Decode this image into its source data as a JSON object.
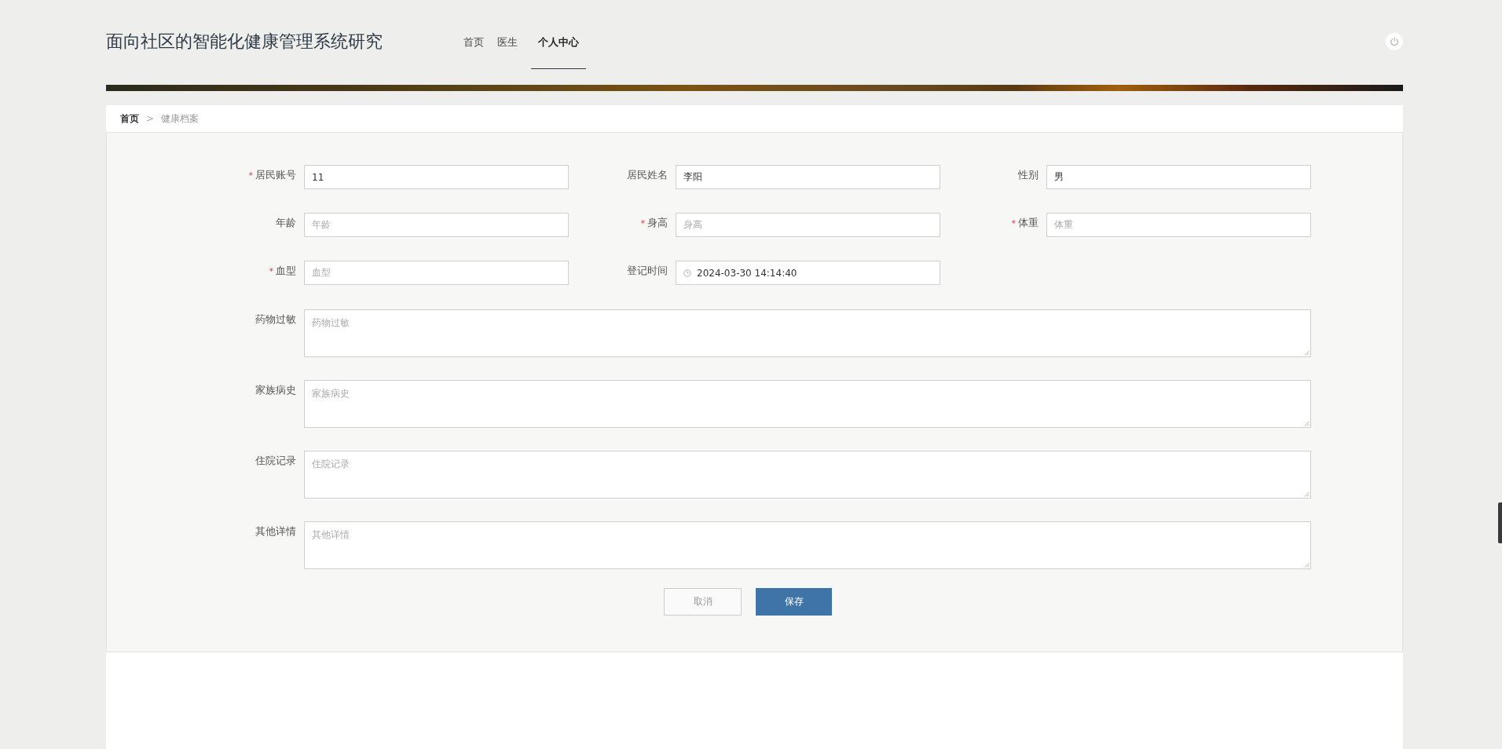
{
  "header": {
    "title": "面向社区的智能化健康管理系统研究",
    "nav": [
      {
        "label": "首页",
        "selected": false
      },
      {
        "label": "医生",
        "selected": false
      },
      {
        "label": "个人中心",
        "selected": true
      }
    ]
  },
  "breadcrumb": {
    "separator": ">",
    "items": [
      {
        "label": "首页",
        "current": false
      },
      {
        "label": "健康档案",
        "current": true
      }
    ]
  },
  "form": {
    "required_mark": "*",
    "fields": [
      {
        "label": "居民账号",
        "required": true,
        "kind": "text",
        "value": "11"
      },
      {
        "label": "居民姓名",
        "required": false,
        "kind": "text",
        "value": "李阳"
      },
      {
        "label": "性别",
        "required": false,
        "kind": "text",
        "value": "男"
      },
      {
        "label": "年龄",
        "required": false,
        "kind": "text",
        "placeholder": "年龄"
      },
      {
        "label": "身高",
        "required": true,
        "kind": "text",
        "placeholder": "身高"
      },
      {
        "label": "体重",
        "required": true,
        "kind": "text",
        "placeholder": "体重"
      },
      {
        "label": "血型",
        "required": true,
        "kind": "text",
        "placeholder": "血型"
      },
      {
        "label": "登记时间",
        "required": false,
        "kind": "datetime",
        "value": "2024-03-30 14:14:40"
      }
    ],
    "textareas": [
      {
        "label": "药物过敏",
        "placeholder": "药物过敏"
      },
      {
        "label": "家族病史",
        "placeholder": "家族病史"
      },
      {
        "label": "住院记录",
        "placeholder": "住院记录"
      },
      {
        "label": "其他详情",
        "placeholder": "其他详情"
      }
    ],
    "buttons": [
      {
        "label": "取消",
        "kind": "secondary"
      },
      {
        "label": "保存",
        "kind": "primary"
      }
    ]
  }
}
